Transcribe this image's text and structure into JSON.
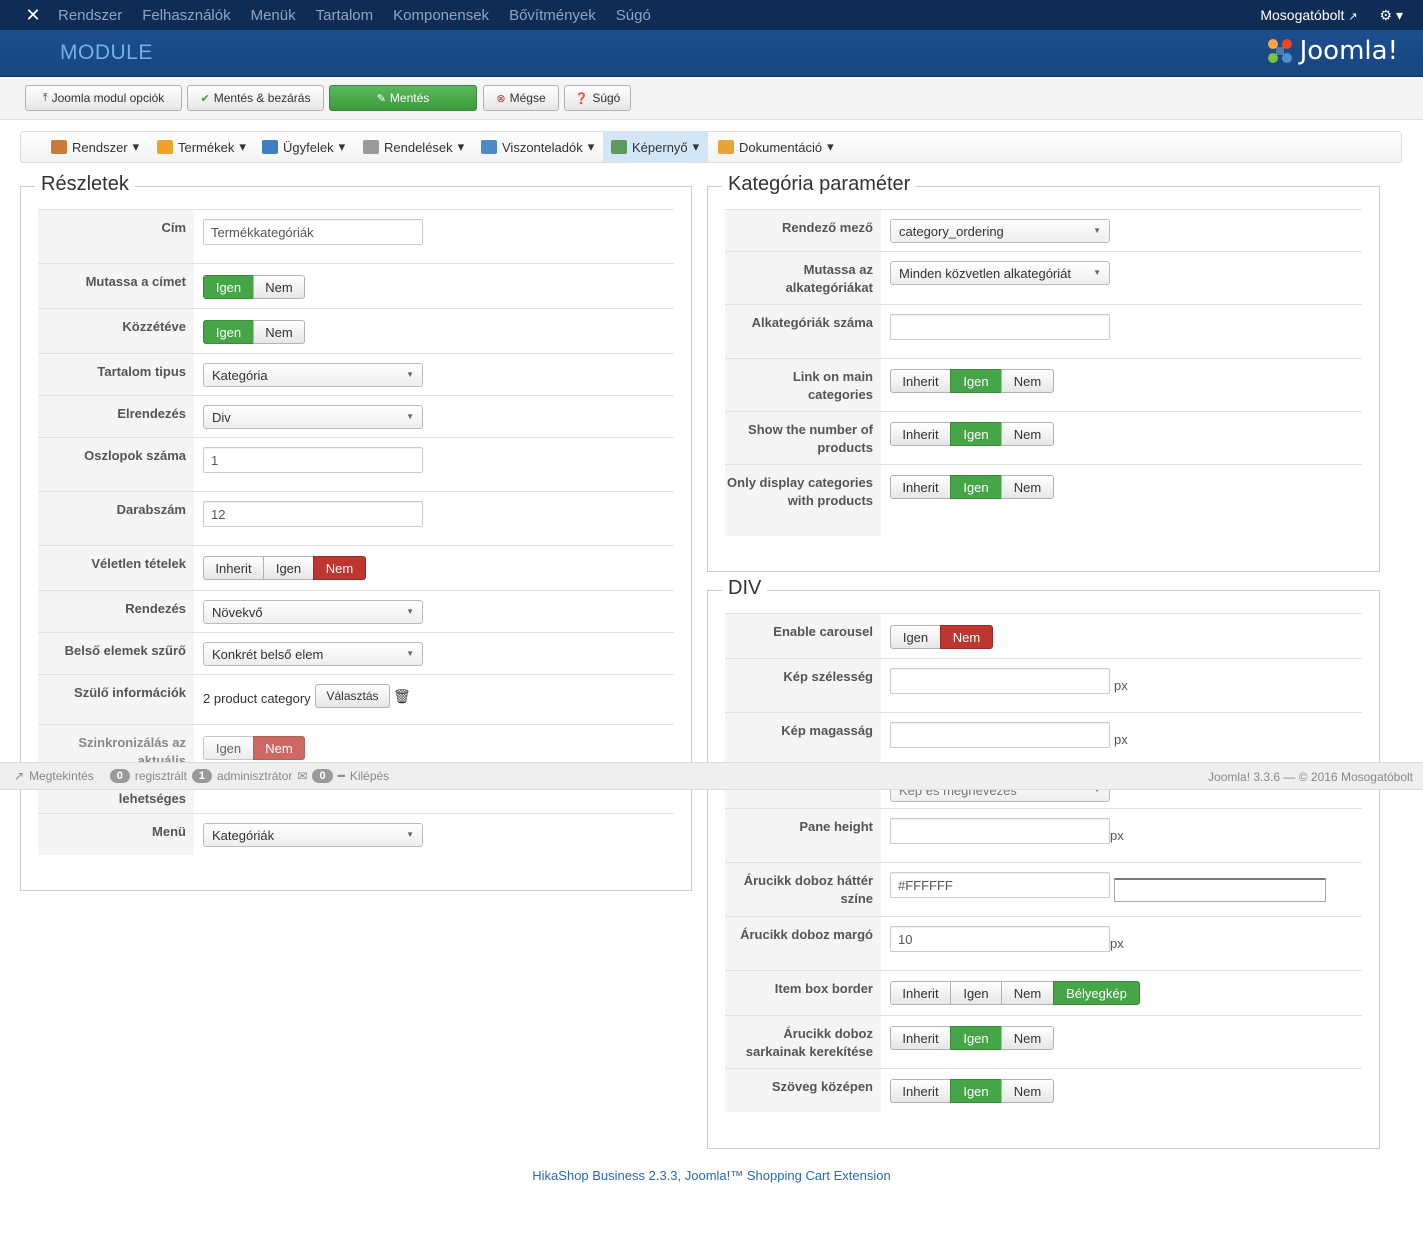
{
  "topnav": {
    "menu": [
      "Rendszer",
      "Felhasználók",
      "Menük",
      "Tartalom",
      "Komponensek",
      "Bővítmények",
      "Súgó"
    ],
    "site_link": "Mosogatóbolt"
  },
  "header": {
    "title": "MODULE",
    "brand": "Joomla!"
  },
  "toolbar": {
    "options": "Joomla modul opciók",
    "save_close": "Mentés & bezárás",
    "save": "Mentés",
    "cancel": "Mégse",
    "help": "Súgó"
  },
  "submenu": {
    "items": [
      "Rendszer",
      "Termékek",
      "Ügyfelek",
      "Rendelések",
      "Viszonteladók",
      "Képernyő",
      "Dokumentáció"
    ]
  },
  "details": {
    "legend": "Részletek",
    "title_label": "Cím",
    "title_value": "Termékkategóriák",
    "show_title_label": "Mutassa a címet",
    "published_label": "Közzétéve",
    "content_type_label": "Tartalom tipus",
    "content_type_value": "Kategória",
    "layout_label": "Elrendezés",
    "layout_value": "Div",
    "columns_label": "Oszlopok száma",
    "columns_value": "1",
    "count_label": "Darabszám",
    "count_value": "12",
    "random_label": "Véletlen tételek",
    "ordering_label": "Rendezés",
    "ordering_value": "Növekvő",
    "filter_label": "Belső elemek szűrő",
    "filter_value": "Konkrét belső elem",
    "parent_label": "Szülő információk",
    "parent_value": "2 product category",
    "choose": "Választás",
    "sync_label_1": "Szinkronizálás az",
    "sync_label_2": "aktuális",
    "sync_label_3": "lehetséges",
    "menu_label": "Menü",
    "menu_value": "Kategóriák",
    "yes": "Igen",
    "no": "Nem",
    "inherit": "Inherit"
  },
  "catparams": {
    "legend": "Kategória paraméter",
    "order_field_label": "Rendező mező",
    "order_field_value": "category_ordering",
    "show_sub_label": "Mutassa az alkategóriákat",
    "show_sub_value": "Minden közvetlen alkategóriát",
    "sub_count_label": "Alkategóriák száma",
    "link_main_label": "Link on main categories",
    "show_num_label": "Show the number of products",
    "only_display_label": "Only display categories with products"
  },
  "div": {
    "legend": "DIV",
    "carousel_label": "Enable carousel",
    "img_width_label": "Kép szélesség",
    "img_height_label": "Kép magasság",
    "hidden_select_value": "Kép és megnevezés",
    "pane_height_label": "Pane height",
    "bg_color_label": "Árucikk doboz háttér színe",
    "bg_color_value": "#FFFFFF",
    "margin_label": "Árucikk doboz margó",
    "margin_value": "10",
    "border_label": "Item box border",
    "thumbnail": "Bélyegkép",
    "rounded_label": "Árucikk doboz sarkainak kerekítése",
    "center_label": "Szöveg középen",
    "px": "px"
  },
  "status": {
    "preview": "Megtekintés",
    "registered_count": "0",
    "registered": "regisztrált",
    "admin_count": "1",
    "admin": "adminisztrátor",
    "msg_count": "0",
    "logout": "Kilépés",
    "version": "Joomla! 3.3.6 — © 2016 Mosogatóbolt"
  },
  "footer": "HikaShop Business 2.3.3, Joomla!™ Shopping Cart Extension",
  "colors": {
    "green": "#46a546",
    "red": "#bd362f",
    "navy": "#0f2c54",
    "header_blue": "#1c4f8e"
  }
}
